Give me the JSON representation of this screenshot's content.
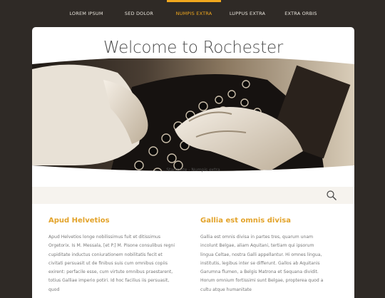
{
  "nav": {
    "items": [
      {
        "label": "LOREM IPSUM",
        "active": false
      },
      {
        "label": "SED DOLOR",
        "active": false
      },
      {
        "label": "NUMPIS EXTRA",
        "active": true
      },
      {
        "label": "LUPPUS EXTRA",
        "active": false
      },
      {
        "label": "EXTRA ORBIS",
        "active": false
      }
    ]
  },
  "page": {
    "title": "Welcome to Rochester",
    "breadcrumb": "Startseite - Numpis extra"
  },
  "search": {
    "icon": "search-icon"
  },
  "columns": [
    {
      "heading": "Apud Helvetios",
      "text": "Apud Helvetios longe nobilissimus fuit et ditissimus Orgetorix. Is M. Messala, [et P.] M. Pisone consulibus regni cupiditate inductus coniurationem nobilitatis fecit et civitati persuasit ut de finibus suis cum omnibus copiis exirent: perfacile esse, cum virtute omnibus praestarent, totius Galliae imperio potiri. Id hoc facilius iis persuasit, quod"
    },
    {
      "heading": "Gallia est omnis divisa",
      "text": "Gallia est omnis divisa in partes tres, quarum unam incolunt Belgae, aliam Aquitani, tertiam qui ipsorum lingua Celtae, nostra Galli appellantur. Hi omnes lingua, institutis, legibus inter se differunt. Gallos ab Aquitanis Garumna flumen, a Belgis Matrona et Sequana dividit. Horum omnium fortissimi sunt Belgae, propterea quod a cultu atque humanitate"
    }
  ],
  "colors": {
    "background": "#2f2a26",
    "accent": "#f1a81e",
    "heading": "#e3a32a",
    "searchbar": "#f6f3ee"
  }
}
